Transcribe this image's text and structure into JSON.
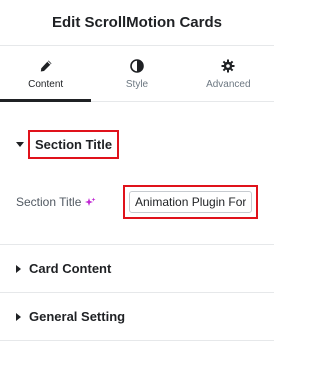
{
  "header": {
    "title": "Edit ScrollMotion Cards"
  },
  "tabs": [
    {
      "label": "Content",
      "icon": "pencil-icon",
      "active": true
    },
    {
      "label": "Style",
      "icon": "half-circle-icon",
      "active": false
    },
    {
      "label": "Advanced",
      "icon": "gear-icon",
      "active": false
    }
  ],
  "section_title": {
    "heading": "Section Title",
    "field_label": "Section Title",
    "ai_icon": "sparkle-icon",
    "input_value": "Animation Plugin For"
  },
  "sections": [
    {
      "label": "Card Content"
    },
    {
      "label": "General Setting"
    }
  ],
  "colors": {
    "highlight": "#e0121b",
    "ai_accent": "#c026d3",
    "text": "#1f2124"
  }
}
